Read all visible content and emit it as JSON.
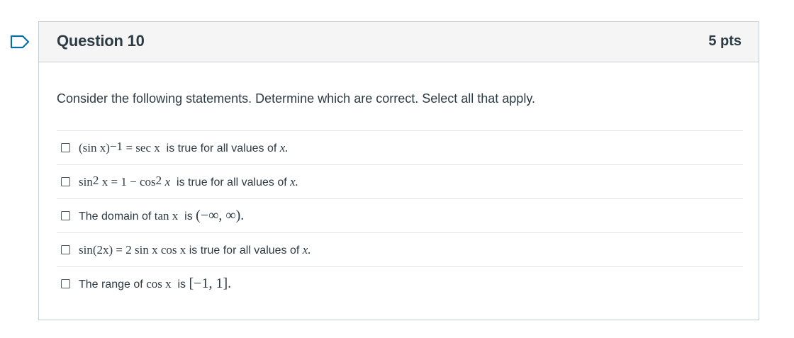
{
  "question": {
    "title": "Question 10",
    "points": "5 pts",
    "prompt": "Consider the following statements. Determine which are correct. Select all that apply."
  },
  "answers": [
    {
      "math_a": "(sin x)",
      "math_a_sup": "−1",
      "math_b": "= sec x",
      "text": "is true for all values of",
      "math_end": "x.",
      "checked": false
    },
    {
      "math_a": "sin",
      "math_a_sup": "2",
      "math_b": "x = 1 − cos",
      "math_b_sup": "2",
      "math_c": "x",
      "text": "is true for all values of",
      "math_end": "x.",
      "checked": false
    },
    {
      "text_a": "The domain of",
      "math_a": "tan x",
      "text_b": "is",
      "math_b": "(−∞, ∞).",
      "checked": false
    },
    {
      "math_a": "sin(2x) = 2 sin x  cos x",
      "text": "is true for all values of",
      "math_end": "x.",
      "checked": false
    },
    {
      "text_a": "The range of",
      "math_a": "cos x",
      "text_b": "is",
      "math_b": "[−1, 1].",
      "checked": false
    }
  ],
  "colors": {
    "border": "#c7cdd1",
    "header_bg": "#f5f5f5",
    "text": "#2d3b45",
    "flag": "#0770a3"
  }
}
